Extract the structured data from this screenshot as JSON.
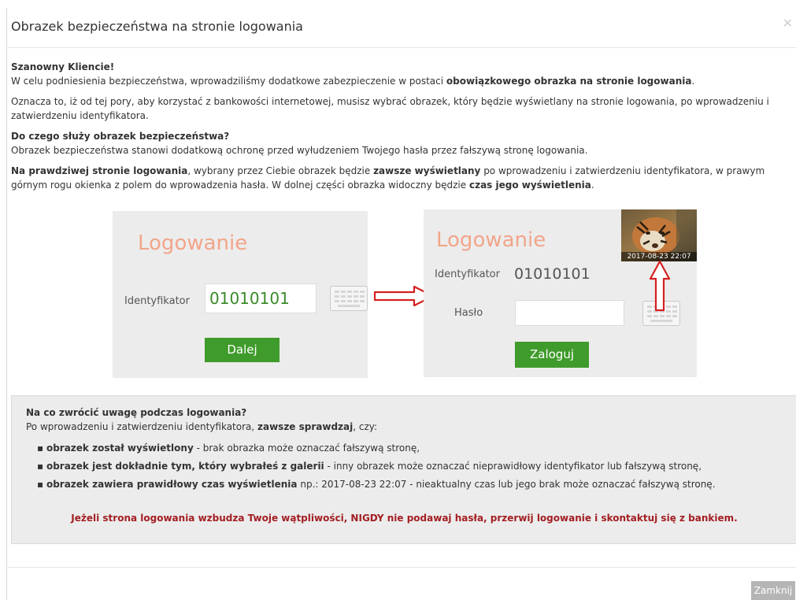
{
  "modal": {
    "title": "Obrazek bezpieczeństwa na stronie logowania",
    "close_symbol": "×"
  },
  "intro": {
    "greeting": "Szanowny Kliencie!",
    "p1_a": "W celu podniesienia bezpieczeństwa, wprowadziliśmy dodatkowe zabezpieczenie w postaci ",
    "p1_b": "obowiązkowego obrazka na stronie logowania",
    "p1_c": ".",
    "p2": "Oznacza to, iż od tej pory, aby korzystać z bankowości internetowej, musisz wybrać obrazek, który będzie wyświetlany na stronie logowania, po wprowadzeniu i zatwierdzeniu identyfikatora.",
    "q_title": "Do czego służy obrazek bezpieczeństwa?",
    "q_text": "Obrazek bezpieczeństwa stanowi dodatkową ochronę przed wyłudzeniem Twojego hasła przez fałszywą stronę logowania.",
    "p3_a": "Na prawdziwej stronie logowania",
    "p3_b": ", wybrany przez Ciebie obrazek będzie ",
    "p3_c": "zawsze wyświetlany",
    "p3_d": " po wprowadzeniu i zatwierdzeniu identyfikatora, w prawym górnym rogu okienka z polem do wprowadzenia hasła. W dolnej części obrazka widoczny będzie ",
    "p3_e": "czas jego wyświetlenia",
    "p3_f": "."
  },
  "illustration": {
    "left": {
      "heading": "Logowanie",
      "id_label": "Identyfikator",
      "id_value": "01010101",
      "button": "Dalej"
    },
    "right": {
      "heading": "Logowanie",
      "id_label": "Identyfikator",
      "id_value": "01010101",
      "password_label": "Hasło",
      "button": "Zaloguj",
      "image_timestamp": "2017-08-23 22:07"
    },
    "colors": {
      "heading": "#f2a58a",
      "button": "#3f9b2b",
      "arrow": "#d62020"
    }
  },
  "warning": {
    "title": "Na co zwrócić uwagę podczas logowania?",
    "intro_a": "Po wprowadzeniu i zatwierdzeniu identyfikatora, ",
    "intro_b": "zawsze sprawdzaj",
    "intro_c": ", czy:",
    "bullets": [
      {
        "bold": "obrazek został wyświetlony",
        "text": " - brak obrazka może oznaczać fałszywą stronę,"
      },
      {
        "bold": "obrazek jest dokładnie tym, który wybrałeś z galerii",
        "text": " - inny obrazek może oznaczać nieprawidłowy identyfikator lub fałszywą stronę,"
      },
      {
        "bold": "obrazek zawiera prawidłowy czas wyświetlenia",
        "text": " np.: 2017-08-23 22:07 - nieaktualny czas lub jego brak może oznaczać fałszywą stronę."
      }
    ],
    "alert": "Jeżeli strona logowania wzbudza Twoje wątpliwości, NIGDY nie podawaj hasła, przerwij logowanie i skontaktuj się z bankiem."
  },
  "footer": {
    "close_button": "Zamknij"
  }
}
